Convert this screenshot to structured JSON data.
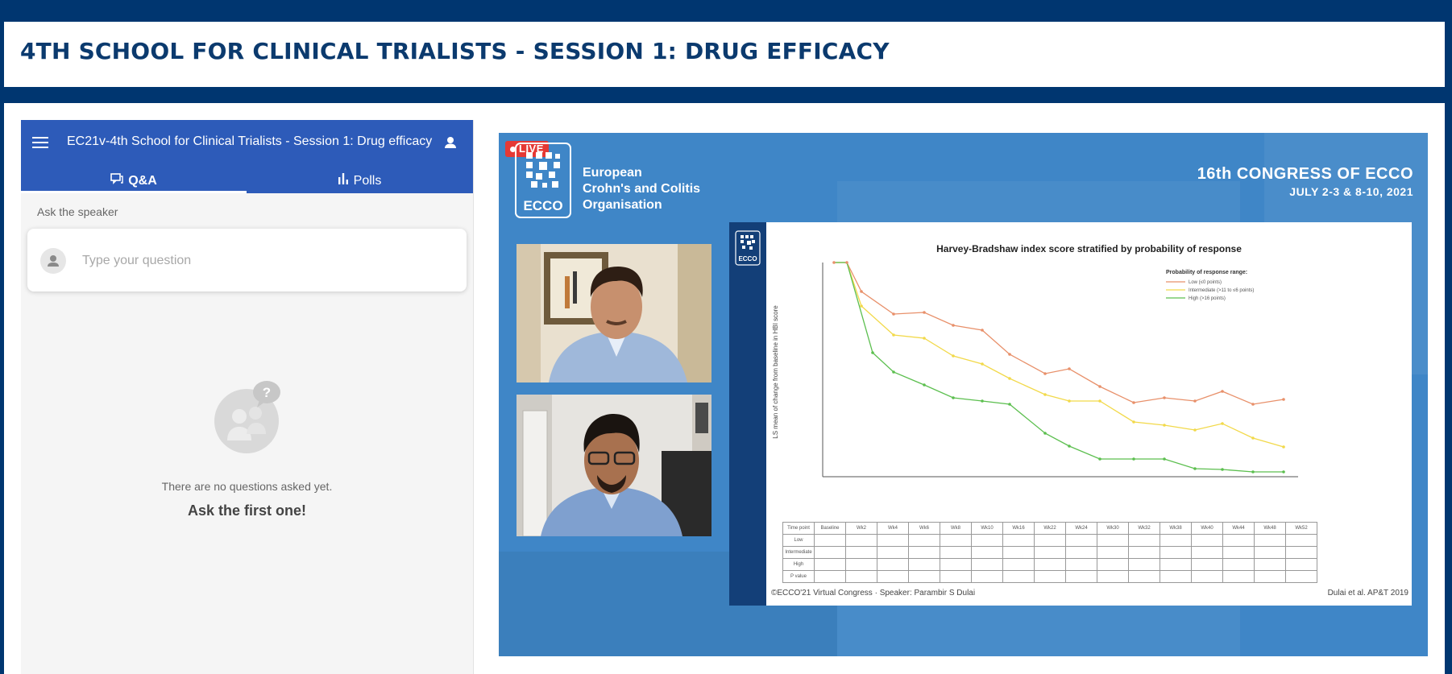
{
  "page": {
    "title": "4TH SCHOOL FOR CLINICAL TRIALISTS - SESSION 1: DRUG EFFICACY",
    "background_color": "#003670"
  },
  "qa_panel": {
    "session_name": "EC21v-4th School for Clinical Trialists - Session 1: Drug efficacy",
    "menu_icon": "hamburger-menu-icon",
    "user_icon": "account-icon",
    "header_color": "#2d5bb9",
    "tabs": [
      {
        "label": "Q&A",
        "icon": "forum-icon",
        "active": true
      },
      {
        "label": "Polls",
        "icon": "bar-chart-icon",
        "active": false
      }
    ],
    "ask_label": "Ask the speaker",
    "question_placeholder": "Type your question",
    "question_value": "",
    "empty_title": "There are no questions asked yet.",
    "empty_cta": "Ask the first one!"
  },
  "video": {
    "live_label": "LIVE",
    "live_color": "#e53935",
    "org_name_lines": [
      "European",
      "Crohn's and Colitis",
      "Organisation"
    ],
    "logo_text": "ECCO",
    "congress_title": "16th CONGRESS OF ECCO",
    "congress_dates": "JULY 2-3 & 8-10, 2021",
    "slide": {
      "title": "Harvey-Bradshaw index score stratified by probability of response",
      "legend_title": "Probability of response range:",
      "legend_items": [
        {
          "label": "Low (≤0 points)",
          "color": "#e8906a"
        },
        {
          "label": "Intermediate (>11 to ≤6 points)",
          "color": "#f2d94a"
        },
        {
          "label": "High (>16 points)",
          "color": "#5cbf4f"
        }
      ],
      "ylabel": "LS mean of change from baseline in HBI score",
      "table_rows": [
        "Time point",
        "Low",
        "Intermediate",
        "High",
        "P value"
      ],
      "table_cols": [
        "Baseline",
        "Wk2",
        "Wk4",
        "Wk6",
        "Wk8",
        "Wk10",
        "Wk16",
        "Wk22",
        "Wk24",
        "Wk30",
        "Wk32",
        "Wk38",
        "Wk40",
        "Wk44",
        "Wk48",
        "Wk52"
      ],
      "footer_left": "©ECCO'21 Virtual Congress · Speaker: Parambir S Dulai",
      "footer_right": "Dulai et al. AP&T 2019"
    }
  }
}
